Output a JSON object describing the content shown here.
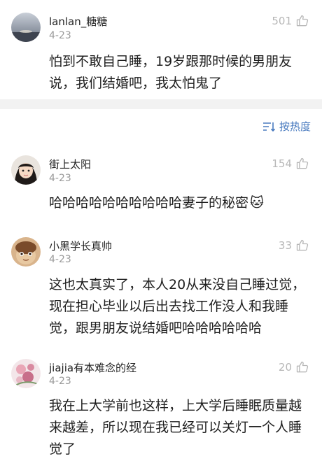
{
  "top_comment": {
    "username": "lanlan_糖糖",
    "date": "4-23",
    "likes": "501",
    "text": "怕到不敢自己睡，19岁跟那时候的男朋友说，我们结婚吧，我太怕鬼了"
  },
  "sort": {
    "label": "按热度",
    "icon": "sort-icon"
  },
  "comments": [
    {
      "username": "街上太阳",
      "date": "4-23",
      "likes": "154",
      "text": "哈哈哈哈哈哈哈哈哈哈妻子的秘密",
      "emoji": "🐱"
    },
    {
      "username": "小黑学长真帅",
      "date": "4-23",
      "likes": "33",
      "text": "这也太真实了，本人20从来没自己睡过觉，现在担心毕业以后出去找工作没人和我睡觉，跟男朋友说结婚吧哈哈哈哈哈哈"
    },
    {
      "username": "jiajia有本难念的经",
      "date": "4-23",
      "likes": "20",
      "text": "我在上大学前也这样，上大学后睡眠质量越来越差，所以现在我已经可以关灯一个人睡觉了"
    }
  ],
  "colors": {
    "accent": "#4a7bbf",
    "muted": "#9a9a9a",
    "divider": "#f2f2f2"
  }
}
